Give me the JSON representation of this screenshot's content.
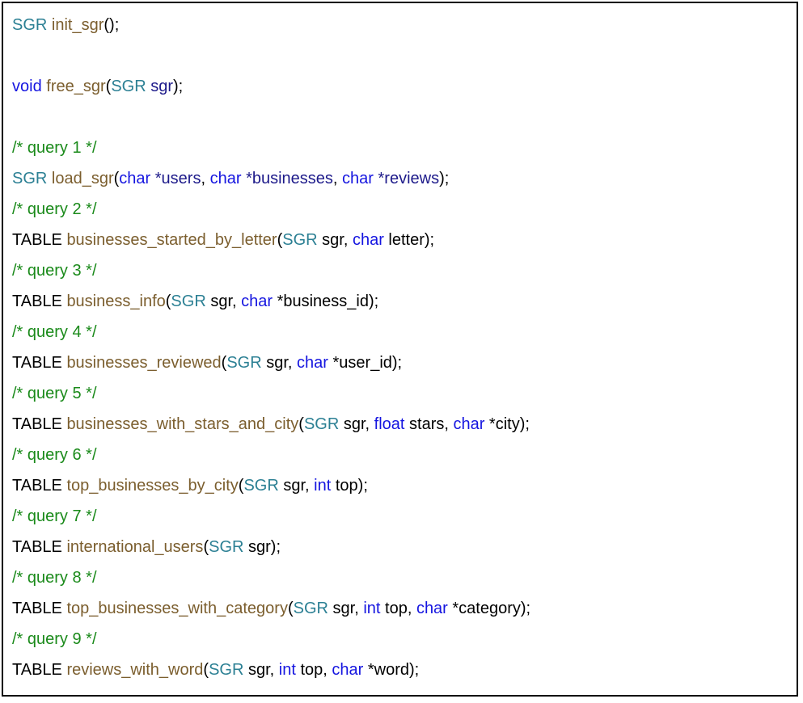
{
  "colors": {
    "type": "#2c8094",
    "function": "#7b5e2e",
    "keyword": "#1515e0",
    "param": "#1d1a8a",
    "comment": "#1a8a1a",
    "plain": "#000000"
  },
  "code_lines": [
    [
      {
        "t": "SGR",
        "c": "type"
      },
      {
        "t": " ",
        "c": "plain"
      },
      {
        "t": "init_sgr",
        "c": "func"
      },
      {
        "t": "();",
        "c": "plain"
      }
    ],
    [],
    [
      {
        "t": "void",
        "c": "kw"
      },
      {
        "t": " ",
        "c": "plain"
      },
      {
        "t": "free_sgr",
        "c": "func"
      },
      {
        "t": "(",
        "c": "plain"
      },
      {
        "t": "SGR",
        "c": "type"
      },
      {
        "t": " ",
        "c": "plain"
      },
      {
        "t": "sgr",
        "c": "param"
      },
      {
        "t": ");",
        "c": "plain"
      }
    ],
    [],
    [
      {
        "t": "/* query 1 */",
        "c": "comment"
      }
    ],
    [
      {
        "t": "SGR",
        "c": "type"
      },
      {
        "t": " ",
        "c": "plain"
      },
      {
        "t": "load_sgr",
        "c": "func"
      },
      {
        "t": "(",
        "c": "plain"
      },
      {
        "t": "char",
        "c": "kw"
      },
      {
        "t": " ",
        "c": "plain"
      },
      {
        "t": "*users",
        "c": "param"
      },
      {
        "t": ", ",
        "c": "plain"
      },
      {
        "t": "char",
        "c": "kw"
      },
      {
        "t": " ",
        "c": "plain"
      },
      {
        "t": "*businesses",
        "c": "param"
      },
      {
        "t": ", ",
        "c": "plain"
      },
      {
        "t": "char",
        "c": "kw"
      },
      {
        "t": " ",
        "c": "plain"
      },
      {
        "t": "*reviews",
        "c": "param"
      },
      {
        "t": ");",
        "c": "plain"
      }
    ],
    [
      {
        "t": "/* query 2 */",
        "c": "comment"
      }
    ],
    [
      {
        "t": "TABLE",
        "c": "plain"
      },
      {
        "t": " ",
        "c": "plain"
      },
      {
        "t": "businesses_started_by_letter",
        "c": "func"
      },
      {
        "t": "(",
        "c": "plain"
      },
      {
        "t": "SGR",
        "c": "type"
      },
      {
        "t": " sgr, ",
        "c": "plain"
      },
      {
        "t": "char",
        "c": "kw"
      },
      {
        "t": " letter);",
        "c": "plain"
      }
    ],
    [
      {
        "t": "/* query 3 */",
        "c": "comment"
      }
    ],
    [
      {
        "t": "TABLE",
        "c": "plain"
      },
      {
        "t": " ",
        "c": "plain"
      },
      {
        "t": "business_info",
        "c": "func"
      },
      {
        "t": "(",
        "c": "plain"
      },
      {
        "t": "SGR",
        "c": "type"
      },
      {
        "t": " sgr, ",
        "c": "plain"
      },
      {
        "t": "char",
        "c": "kw"
      },
      {
        "t": " *business_id);",
        "c": "plain"
      }
    ],
    [
      {
        "t": "/* query 4 */",
        "c": "comment"
      }
    ],
    [
      {
        "t": "TABLE",
        "c": "plain"
      },
      {
        "t": " ",
        "c": "plain"
      },
      {
        "t": "businesses_reviewed",
        "c": "func"
      },
      {
        "t": "(",
        "c": "plain"
      },
      {
        "t": "SGR",
        "c": "type"
      },
      {
        "t": " sgr, ",
        "c": "plain"
      },
      {
        "t": "char",
        "c": "kw"
      },
      {
        "t": " *user_id);",
        "c": "plain"
      }
    ],
    [
      {
        "t": "/* query 5 */",
        "c": "comment"
      }
    ],
    [
      {
        "t": "TABLE",
        "c": "plain"
      },
      {
        "t": " ",
        "c": "plain"
      },
      {
        "t": "businesses_with_stars_and_city",
        "c": "func"
      },
      {
        "t": "(",
        "c": "plain"
      },
      {
        "t": "SGR",
        "c": "type"
      },
      {
        "t": " sgr, ",
        "c": "plain"
      },
      {
        "t": "float",
        "c": "kw"
      },
      {
        "t": " stars, ",
        "c": "plain"
      },
      {
        "t": "char",
        "c": "kw"
      },
      {
        "t": " *city);",
        "c": "plain"
      }
    ],
    [
      {
        "t": "/* query 6 */",
        "c": "comment"
      }
    ],
    [
      {
        "t": "TABLE",
        "c": "plain"
      },
      {
        "t": " ",
        "c": "plain"
      },
      {
        "t": "top_businesses_by_city",
        "c": "func"
      },
      {
        "t": "(",
        "c": "plain"
      },
      {
        "t": "SGR",
        "c": "type"
      },
      {
        "t": " sgr, ",
        "c": "plain"
      },
      {
        "t": "int",
        "c": "kw"
      },
      {
        "t": " top);",
        "c": "plain"
      }
    ],
    [
      {
        "t": "/* query 7 */",
        "c": "comment"
      }
    ],
    [
      {
        "t": "TABLE",
        "c": "plain"
      },
      {
        "t": " ",
        "c": "plain"
      },
      {
        "t": "international_users",
        "c": "func"
      },
      {
        "t": "(",
        "c": "plain"
      },
      {
        "t": "SGR",
        "c": "type"
      },
      {
        "t": " sgr);",
        "c": "plain"
      }
    ],
    [
      {
        "t": "/* query 8 */",
        "c": "comment"
      }
    ],
    [
      {
        "t": "TABLE",
        "c": "plain"
      },
      {
        "t": " ",
        "c": "plain"
      },
      {
        "t": "top_businesses_with_category",
        "c": "func"
      },
      {
        "t": "(",
        "c": "plain"
      },
      {
        "t": "SGR",
        "c": "type"
      },
      {
        "t": " sgr, ",
        "c": "plain"
      },
      {
        "t": "int",
        "c": "kw"
      },
      {
        "t": " top, ",
        "c": "plain"
      },
      {
        "t": "char",
        "c": "kw"
      },
      {
        "t": " *category);",
        "c": "plain"
      }
    ],
    [
      {
        "t": "/* query 9 */",
        "c": "comment"
      }
    ],
    [
      {
        "t": "TABLE",
        "c": "plain"
      },
      {
        "t": " ",
        "c": "plain"
      },
      {
        "t": "reviews_with_word",
        "c": "func"
      },
      {
        "t": "(",
        "c": "plain"
      },
      {
        "t": "SGR",
        "c": "type"
      },
      {
        "t": " sgr, ",
        "c": "plain"
      },
      {
        "t": "int",
        "c": "kw"
      },
      {
        "t": " top, ",
        "c": "plain"
      },
      {
        "t": "char",
        "c": "kw"
      },
      {
        "t": " *word);",
        "c": "plain"
      }
    ]
  ]
}
